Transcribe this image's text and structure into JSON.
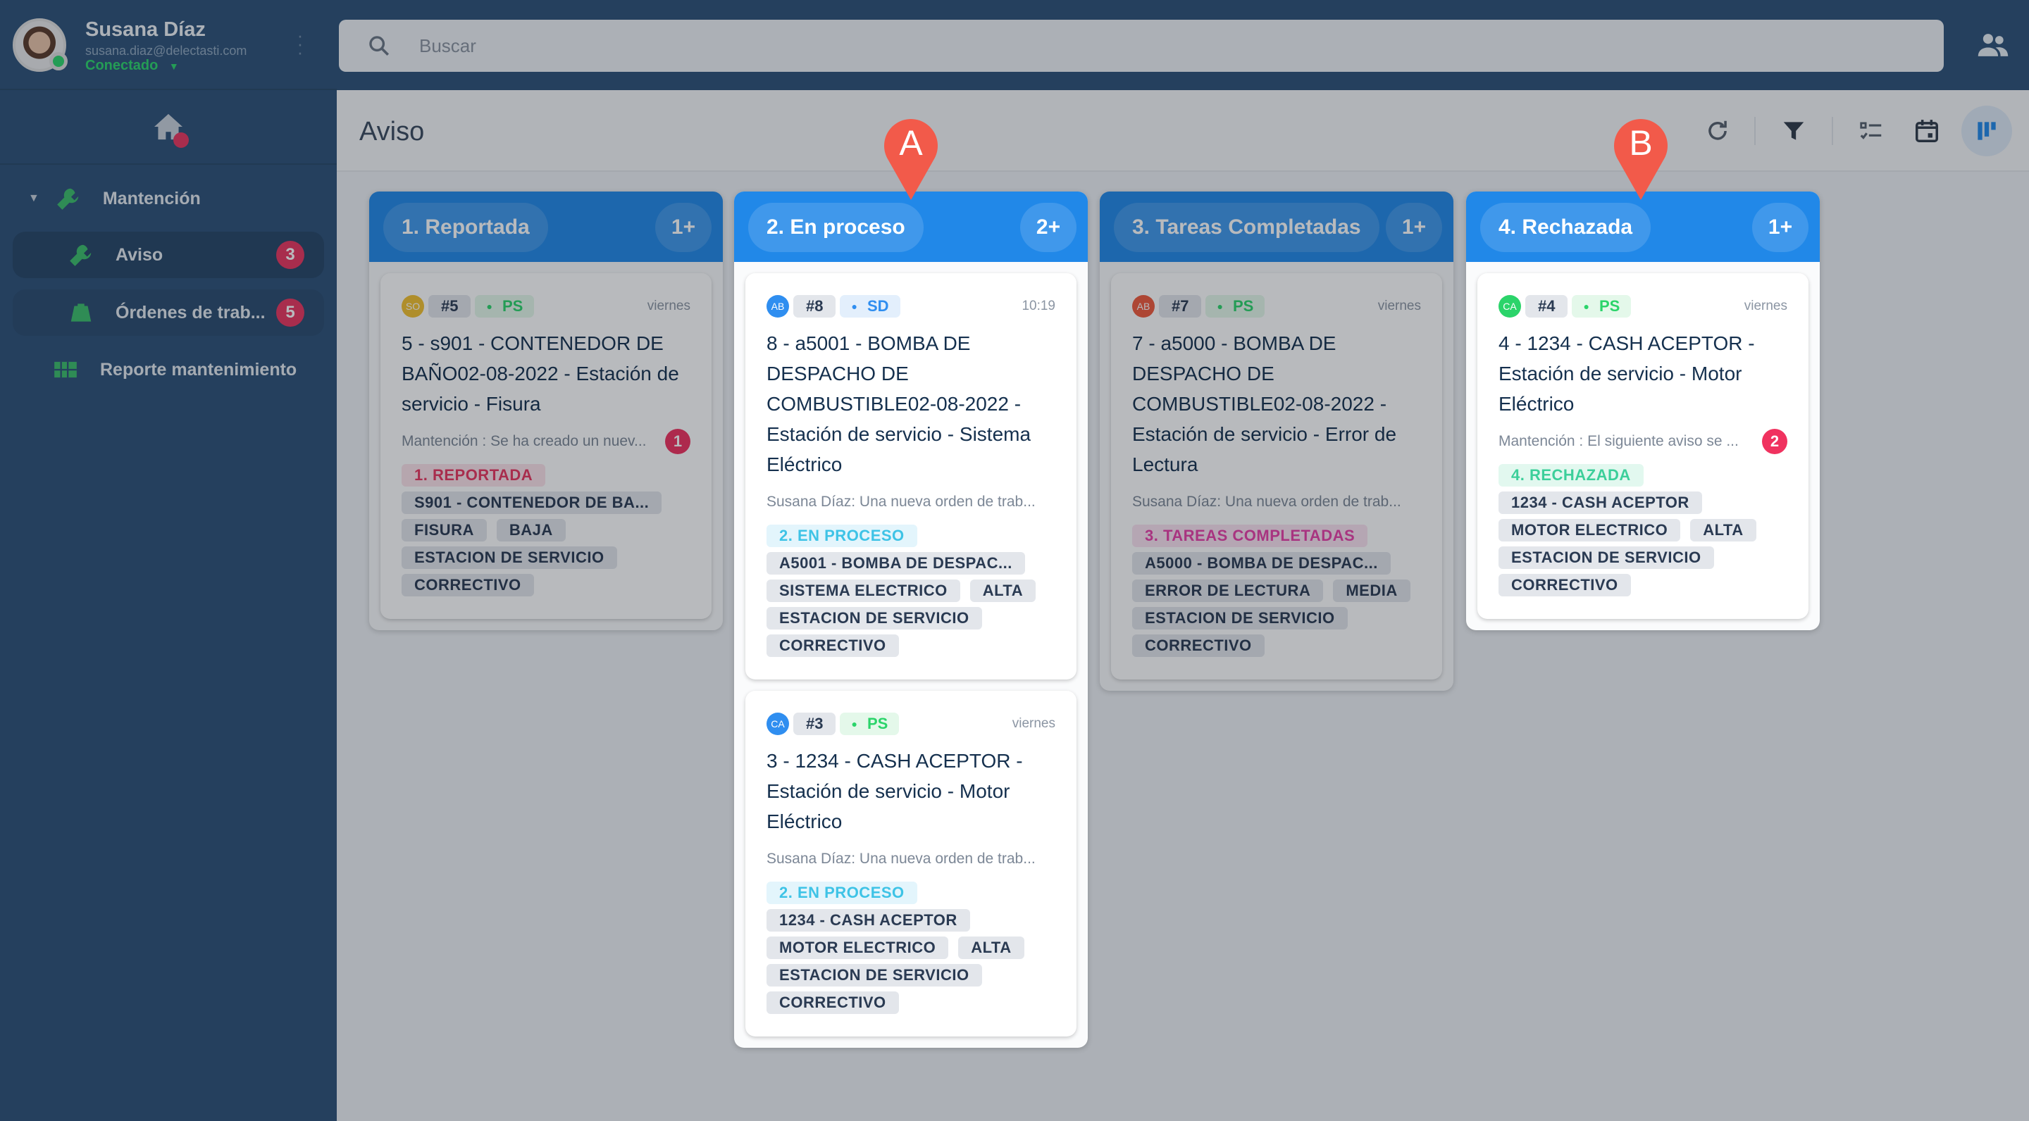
{
  "user": {
    "name": "Susana Díaz",
    "email": "susana.diaz@delectasti.com",
    "status": "Conectado"
  },
  "sidebar": {
    "section": "Mantención",
    "items": [
      {
        "label": "Aviso",
        "badge": "3"
      },
      {
        "label": "Órdenes de trab...",
        "badge": "5"
      },
      {
        "label": "Reporte mantenimiento"
      }
    ]
  },
  "search": {
    "placeholder": "Buscar"
  },
  "page": {
    "title": "Aviso"
  },
  "markers": [
    "A",
    "B"
  ],
  "columns": [
    {
      "name": "1. Reportada",
      "count": "1+",
      "highlight": false,
      "cards": [
        {
          "avatar": "SO",
          "avatar_color": "#f2c12e",
          "num": "#5",
          "user": "PS",
          "user_color": "#2bd46a",
          "user_bg": "#e4f8ea",
          "time": "viernes",
          "title": "5 - s901 - CONTENEDOR DE BAÑO02-08-2022 - Estación de servicio - Fisura",
          "message": "Mantención : Se ha creado un nuev...",
          "msg_badge": "1",
          "status": "1. REPORTADA",
          "status_color": "#e8355f",
          "status_bg": "#fde3ea",
          "tags": [
            "S901 - CONTENEDOR DE BA...",
            "FISURA",
            "BAJA",
            "ESTACION DE SERVICIO",
            "CORRECTIVO"
          ]
        }
      ]
    },
    {
      "name": "2. En proceso",
      "count": "2+",
      "highlight": true,
      "cards": [
        {
          "avatar": "AB",
          "avatar_color": "#2f8ef0",
          "num": "#8",
          "user": "SD",
          "user_color": "#2f8ef0",
          "user_bg": "#e3effc",
          "time": "10:19",
          "title": "8 - a5001 - BOMBA DE DESPACHO DE COMBUSTIBLE02-08-2022 - Estación de servicio - Sistema Eléctrico",
          "message": "Susana Díaz: Una nueva orden de trab...",
          "status": "2. EN PROCESO",
          "status_color": "#3ec3e6",
          "status_bg": "#e3f5fc",
          "tags": [
            "A5001 - BOMBA DE DESPAC...",
            "SISTEMA ELECTRICO",
            "ALTA",
            "ESTACION DE SERVICIO",
            "CORRECTIVO"
          ]
        },
        {
          "avatar": "CA",
          "avatar_color": "#2f8ef0",
          "num": "#3",
          "user": "PS",
          "user_color": "#2bd46a",
          "user_bg": "#e4f8ea",
          "time": "viernes",
          "title": "3 - 1234 - CASH ACEPTOR - Estación de servicio - Motor Eléctrico",
          "message": "Susana Díaz: Una nueva orden de trab...",
          "status": "2. EN PROCESO",
          "status_color": "#3ec3e6",
          "status_bg": "#e3f5fc",
          "tags": [
            "1234 - CASH ACEPTOR",
            "MOTOR ELECTRICO",
            "ALTA",
            "ESTACION DE SERVICIO",
            "CORRECTIVO"
          ]
        }
      ]
    },
    {
      "name": "3. Tareas Completadas",
      "count": "1+",
      "highlight": false,
      "cards": [
        {
          "avatar": "AB",
          "avatar_color": "#ef5a3c",
          "num": "#7",
          "user": "PS",
          "user_color": "#2bd46a",
          "user_bg": "#e4f8ea",
          "time": "viernes",
          "title": "7 - a5000 - BOMBA DE DESPACHO DE COMBUSTIBLE02-08-2022 - Estación de servicio - Error de Lectura",
          "message": "Susana Díaz: Una nueva orden de trab...",
          "status": "3. TAREAS COMPLETADAS",
          "status_color": "#e83fa8",
          "status_bg": "#fbe2f1",
          "tags": [
            "A5000 - BOMBA DE DESPAC...",
            "ERROR DE LECTURA",
            "MEDIA",
            "ESTACION DE SERVICIO",
            "CORRECTIVO"
          ]
        }
      ]
    },
    {
      "name": "4. Rechazada",
      "count": "1+",
      "highlight": true,
      "cards": [
        {
          "avatar": "CA",
          "avatar_color": "#2bd46a",
          "num": "#4",
          "user": "PS",
          "user_color": "#2bd46a",
          "user_bg": "#e4f8ea",
          "time": "viernes",
          "title": "4 - 1234 - CASH ACEPTOR - Estación de servicio - Motor Eléctrico",
          "message": "Mantención : El siguiente aviso se ...",
          "msg_badge": "2",
          "status": "4. RECHAZADA",
          "status_color": "#3ccf9a",
          "status_bg": "#e2f8ef",
          "tags": [
            "1234 - CASH ACEPTOR",
            "MOTOR ELECTRICO",
            "ALTA",
            "ESTACION DE SERVICIO",
            "CORRECTIVO"
          ]
        }
      ]
    }
  ]
}
